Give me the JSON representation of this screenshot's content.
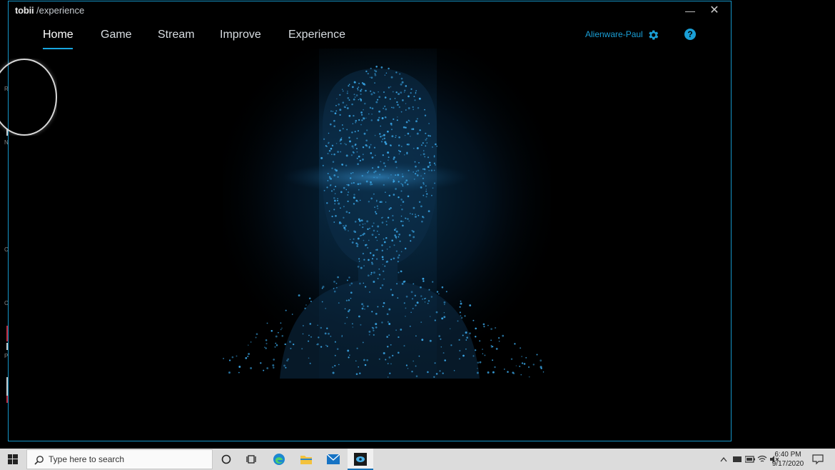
{
  "window": {
    "brand_logo": "tobii",
    "brand_sub": " /experience",
    "minimize_glyph": "—",
    "close_glyph": "✕"
  },
  "nav": {
    "tabs": [
      {
        "label": "Home",
        "active": true
      },
      {
        "label": "Game",
        "active": false
      },
      {
        "label": "Stream",
        "active": false
      },
      {
        "label": "Improve",
        "active": false
      },
      {
        "label": "Experience",
        "active": false
      }
    ]
  },
  "user": {
    "name": "Alienware-Paul",
    "help_glyph": "?"
  },
  "desktop_strip": {
    "glyphs": [
      "R",
      "N",
      "C",
      "C",
      "P"
    ]
  },
  "taskbar": {
    "search_placeholder": "Type here to search",
    "time": "6:40 PM",
    "date": "9/17/2020"
  },
  "colors": {
    "accent": "#1a9fd6",
    "window_border": "#1596c9",
    "background": "#000000",
    "taskbar": "#dcdcdc"
  },
  "icons": {
    "start": "windows-logo-icon",
    "search": "search-icon",
    "cortana": "cortana-circle-icon",
    "task_view": "task-view-icon",
    "edge": "edge-browser-icon",
    "explorer": "file-explorer-icon",
    "mail": "mail-icon",
    "tobii": "tobii-app-icon",
    "gear": "gear-icon",
    "help": "help-icon"
  }
}
